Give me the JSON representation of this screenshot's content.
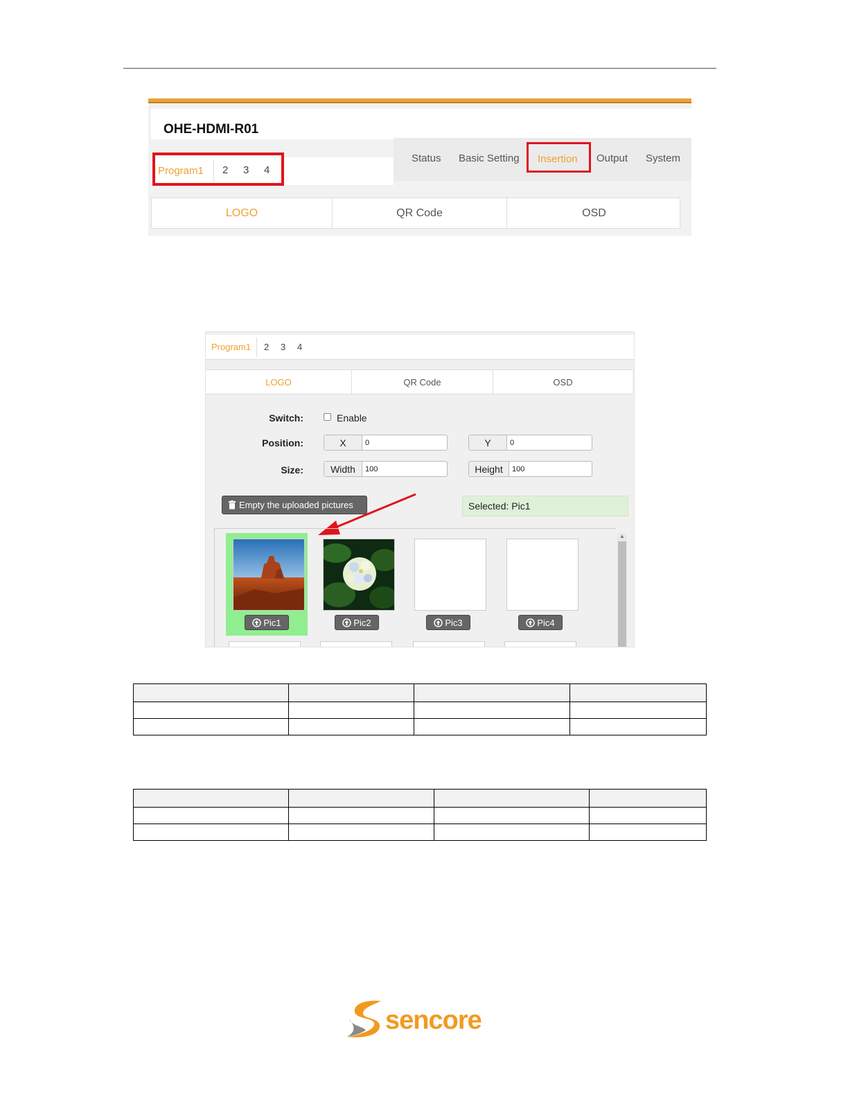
{
  "screen1": {
    "device_title": "OHE-HDMI-R01",
    "programs": [
      "Program1",
      "2",
      "3",
      "4"
    ],
    "nav": [
      "Status",
      "Basic Setting",
      "Insertion",
      "Output",
      "System"
    ],
    "subtabs": [
      "LOGO",
      "QR Code",
      "OSD"
    ]
  },
  "screen2": {
    "programs": [
      "Program1",
      "2",
      "3",
      "4"
    ],
    "subtabs": [
      "LOGO",
      "QR Code",
      "OSD"
    ],
    "switch_label": "Switch:",
    "enable_label": "Enable",
    "position_label": "Position:",
    "x_label": "X",
    "x_value": "0",
    "y_label": "Y",
    "y_value": "0",
    "size_label": "Size:",
    "width_label": "Width",
    "width_value": "100",
    "height_label": "Height",
    "height_value": "100",
    "empty_button": "Empty the uploaded pictures",
    "selected_text": "Selected: Pic1",
    "pictures": [
      "Pic1",
      "Pic2",
      "Pic3",
      "Pic4"
    ]
  },
  "colors": {
    "accent_orange": "#f0a030",
    "highlight_red": "#e0141c",
    "selected_green": "#90ee90",
    "logo_orange": "#f29a1f",
    "logo_gray": "#8a8a8a"
  },
  "footer": {
    "logo_text": "sencore"
  }
}
